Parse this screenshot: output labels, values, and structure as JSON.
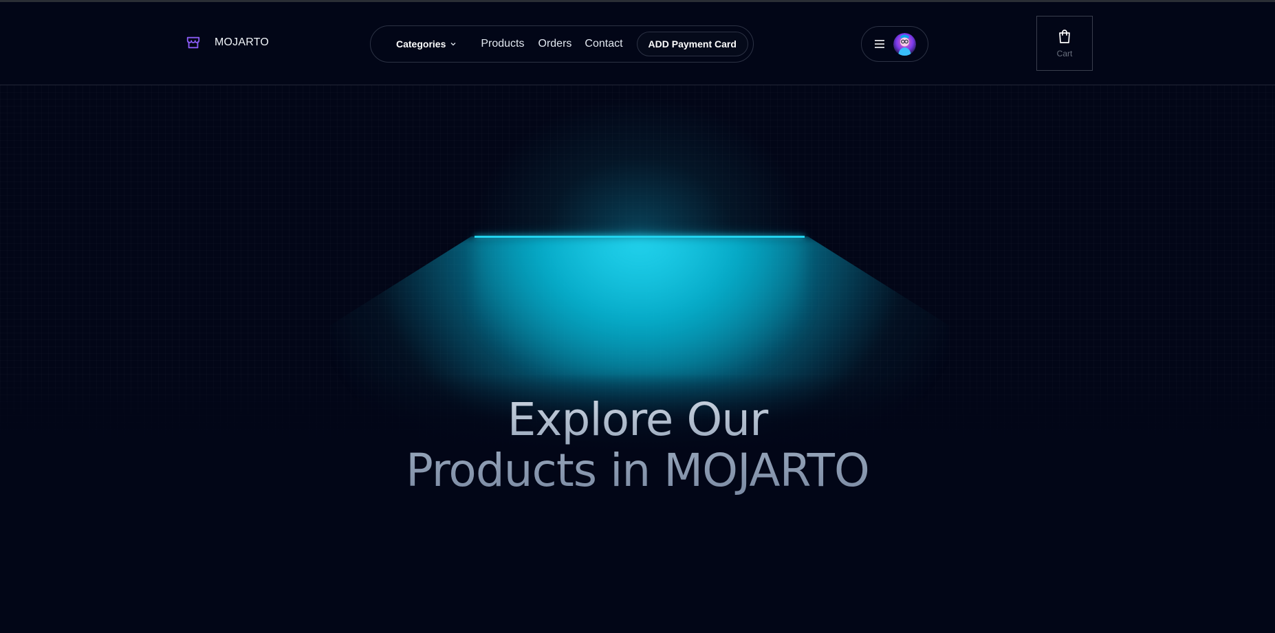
{
  "brand": {
    "name": "MOJARTO",
    "icon": "store-icon",
    "accent": "#8b5cf6"
  },
  "nav": {
    "categories_label": "Categories",
    "links": [
      "Products",
      "Orders",
      "Contact"
    ],
    "payment_button": "ADD Payment Card"
  },
  "user": {
    "menu_icon": "menu-icon",
    "avatar": "avatar"
  },
  "cart": {
    "label": "Cart",
    "icon": "shopping-bag-icon"
  },
  "hero": {
    "title_line1": "Explore Our",
    "title_line2": "Products in MOJARTO",
    "lamp_color": "#22d3ee",
    "background": "#020617"
  }
}
